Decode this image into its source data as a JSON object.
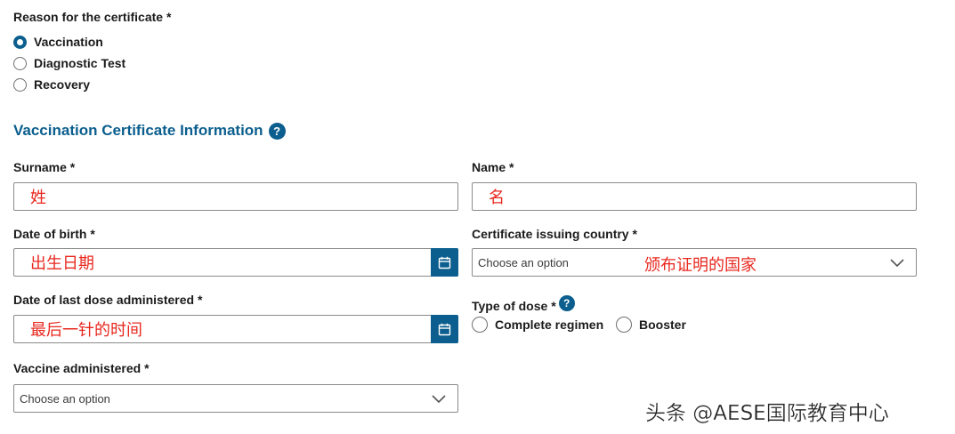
{
  "reason": {
    "label": "Reason for the certificate *",
    "options": [
      "Vaccination",
      "Diagnostic Test",
      "Recovery"
    ],
    "selected": "Vaccination"
  },
  "section": {
    "title": "Vaccination Certificate Information",
    "help_icon": "?"
  },
  "surname": {
    "label": "Surname *",
    "value": "姓"
  },
  "name": {
    "label": "Name *",
    "value": "名"
  },
  "dob": {
    "label": "Date of birth *",
    "value": "出生日期",
    "icon": "calendar-icon"
  },
  "country": {
    "label": "Certificate issuing country *",
    "placeholder": "Choose an option",
    "annotation": "颁布证明的国家"
  },
  "last_dose": {
    "label": "Date of last dose administered *",
    "value": "最后一针的时间",
    "icon": "calendar-icon"
  },
  "dose_type": {
    "label": "Type of dose *",
    "help_icon": "?",
    "options": [
      "Complete regimen",
      "Booster"
    ]
  },
  "vaccine": {
    "label": "Vaccine administered *",
    "placeholder": "Choose an option"
  },
  "watermark": "头条 @AESE国际教育中心",
  "colors": {
    "accent": "#0b5e8e",
    "annotation_red": "#e8281f"
  }
}
